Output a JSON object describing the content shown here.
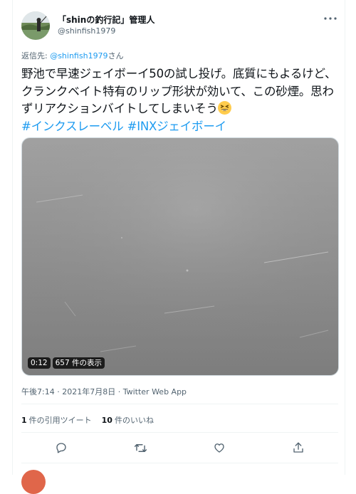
{
  "tweet": {
    "display_name": "「shinの釣行記」管理人",
    "handle": "@shinfish1979",
    "reply_prefix": "返信先: ",
    "reply_handle": "@shinfish1979",
    "reply_suffix": "さん",
    "text": "野池で早速ジェイボーイ50の試し投げ。底質にもよるけど、クランクベイト特有のリップ形状が効いて、この砂煙。思わずリアクションバイトしてしまいそう",
    "hashtags": [
      "#インクスレーベル",
      "#INXジェイボーイ"
    ],
    "emoji": "grinning-squinting-face-emoji"
  },
  "video": {
    "duration": "0:12",
    "views": "657 件の表示"
  },
  "meta": {
    "time": "午後7:14",
    "separator": " · ",
    "date": "2021年7月8日",
    "source": "Twitter Web App"
  },
  "stats": {
    "quote_count": "1",
    "quote_label": "件の引用ツイート",
    "like_count": "10",
    "like_label": "件のいいね"
  },
  "icons": {
    "more": "more-icon",
    "reply": "reply-icon",
    "retweet": "retweet-icon",
    "like": "like-icon",
    "share": "share-icon"
  },
  "colors": {
    "accent": "#1d9bf0",
    "secondary_text": "#536471",
    "divider": "#eff3f4"
  }
}
